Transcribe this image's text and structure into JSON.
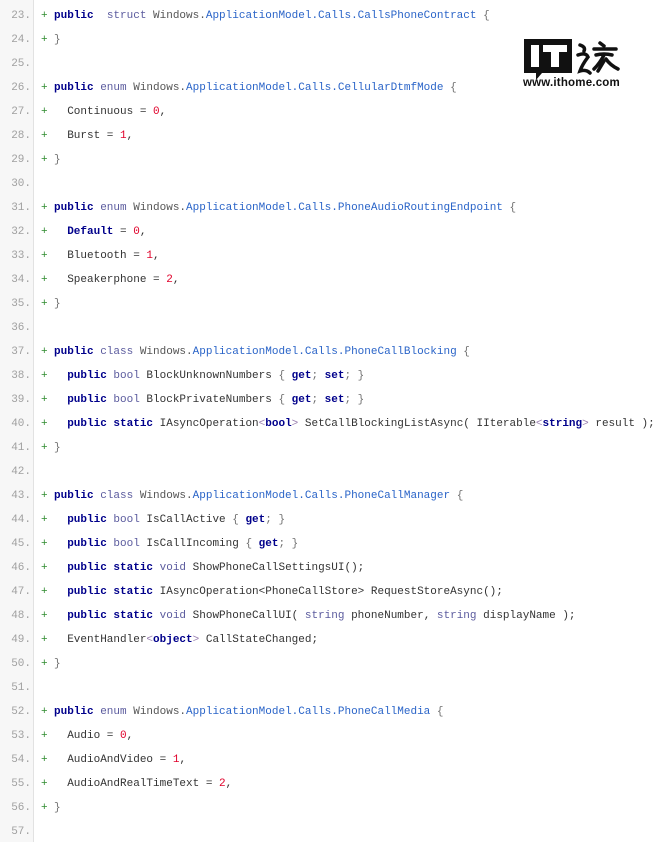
{
  "watermark": {
    "logo_text": "IT之家",
    "url": "www.ithome.com"
  },
  "colors": {
    "plus": "#2e8b2e",
    "keyword": "#00008b",
    "type": "#5b5b9e",
    "class_name": "#2a64c8",
    "number": "#e0002a"
  },
  "lines": [
    {
      "n": "23.",
      "plus": "+",
      "tokens": [
        [
          "kw",
          "public"
        ],
        [
          "",
          "  "
        ],
        [
          "ty",
          "struct"
        ],
        [
          "ns",
          " Windows."
        ],
        [
          "cls",
          "ApplicationModel.Calls.CallsPhoneContract"
        ],
        [
          "br",
          " {"
        ]
      ]
    },
    {
      "n": "24.",
      "plus": "+",
      "tokens": [
        [
          "br",
          "}"
        ]
      ]
    },
    {
      "n": "25.",
      "plus": "",
      "tokens": []
    },
    {
      "n": "26.",
      "plus": "+",
      "tokens": [
        [
          "kw",
          "public"
        ],
        [
          "ty",
          " enum"
        ],
        [
          "ns",
          " Windows."
        ],
        [
          "cls",
          "ApplicationModel.Calls.CellularDtmfMode"
        ],
        [
          "br",
          " {"
        ]
      ]
    },
    {
      "n": "27.",
      "plus": "+",
      "tokens": [
        [
          "",
          "  Continuous = "
        ],
        [
          "num",
          "0"
        ],
        [
          "",
          ","
        ]
      ]
    },
    {
      "n": "28.",
      "plus": "+",
      "tokens": [
        [
          "",
          "  Burst = "
        ],
        [
          "num",
          "1"
        ],
        [
          "",
          ","
        ]
      ]
    },
    {
      "n": "29.",
      "plus": "+",
      "tokens": [
        [
          "br",
          "}"
        ]
      ]
    },
    {
      "n": "30.",
      "plus": "",
      "tokens": []
    },
    {
      "n": "31.",
      "plus": "+",
      "tokens": [
        [
          "kw",
          "public"
        ],
        [
          "ty",
          " enum"
        ],
        [
          "ns",
          " Windows."
        ],
        [
          "cls",
          "ApplicationModel.Calls.PhoneAudioRoutingEndpoint"
        ],
        [
          "br",
          " {"
        ]
      ]
    },
    {
      "n": "32.",
      "plus": "+",
      "tokens": [
        [
          "",
          "  "
        ],
        [
          "kw",
          "Default"
        ],
        [
          "",
          " = "
        ],
        [
          "num",
          "0"
        ],
        [
          "",
          ","
        ]
      ]
    },
    {
      "n": "33.",
      "plus": "+",
      "tokens": [
        [
          "",
          "  Bluetooth = "
        ],
        [
          "num",
          "1"
        ],
        [
          "",
          ","
        ]
      ]
    },
    {
      "n": "34.",
      "plus": "+",
      "tokens": [
        [
          "",
          "  Speakerphone = "
        ],
        [
          "num",
          "2"
        ],
        [
          "",
          ","
        ]
      ]
    },
    {
      "n": "35.",
      "plus": "+",
      "tokens": [
        [
          "br",
          "}"
        ]
      ]
    },
    {
      "n": "36.",
      "plus": "",
      "tokens": []
    },
    {
      "n": "37.",
      "plus": "+",
      "tokens": [
        [
          "kw",
          "public"
        ],
        [
          "ty",
          " class"
        ],
        [
          "ns",
          " Windows."
        ],
        [
          "cls",
          "ApplicationModel.Calls.PhoneCallBlocking"
        ],
        [
          "br",
          " {"
        ]
      ]
    },
    {
      "n": "38.",
      "plus": "+",
      "tokens": [
        [
          "",
          "  "
        ],
        [
          "kw",
          "public"
        ],
        [
          "ty",
          " bool"
        ],
        [
          "",
          " BlockUnknownNumbers "
        ],
        [
          "br",
          "{ "
        ],
        [
          "kw",
          "get"
        ],
        [
          "br",
          "; "
        ],
        [
          "kw",
          "set"
        ],
        [
          "br",
          "; }"
        ]
      ]
    },
    {
      "n": "39.",
      "plus": "+",
      "tokens": [
        [
          "",
          "  "
        ],
        [
          "kw",
          "public"
        ],
        [
          "ty",
          " bool"
        ],
        [
          "",
          " BlockPrivateNumbers "
        ],
        [
          "br",
          "{ "
        ],
        [
          "kw",
          "get"
        ],
        [
          "br",
          "; "
        ],
        [
          "kw",
          "set"
        ],
        [
          "br",
          "; }"
        ]
      ]
    },
    {
      "n": "40.",
      "plus": "+",
      "tokens": [
        [
          "",
          "  "
        ],
        [
          "kw",
          "public static"
        ],
        [
          "",
          " IAsyncOperation"
        ],
        [
          "ang",
          "<"
        ],
        [
          "kw",
          "bool"
        ],
        [
          "ang",
          ">"
        ],
        [
          "",
          " SetCallBlockingListAsync( IIterable"
        ],
        [
          "ang",
          "<"
        ],
        [
          "kw",
          "string"
        ],
        [
          "ang",
          ">"
        ],
        [
          "",
          " result );"
        ]
      ]
    },
    {
      "n": "41.",
      "plus": "+",
      "tokens": [
        [
          "br",
          "}"
        ]
      ]
    },
    {
      "n": "42.",
      "plus": "",
      "tokens": []
    },
    {
      "n": "43.",
      "plus": "+",
      "tokens": [
        [
          "kw",
          "public"
        ],
        [
          "ty",
          " class"
        ],
        [
          "ns",
          " Windows."
        ],
        [
          "cls",
          "ApplicationModel.Calls.PhoneCallManager"
        ],
        [
          "br",
          " {"
        ]
      ]
    },
    {
      "n": "44.",
      "plus": "+",
      "tokens": [
        [
          "",
          "  "
        ],
        [
          "kw",
          "public"
        ],
        [
          "ty",
          " bool"
        ],
        [
          "",
          " IsCallActive "
        ],
        [
          "br",
          "{ "
        ],
        [
          "kw",
          "get"
        ],
        [
          "br",
          "; }"
        ]
      ]
    },
    {
      "n": "45.",
      "plus": "+",
      "tokens": [
        [
          "",
          "  "
        ],
        [
          "kw",
          "public"
        ],
        [
          "ty",
          " bool"
        ],
        [
          "",
          " IsCallIncoming "
        ],
        [
          "br",
          "{ "
        ],
        [
          "kw",
          "get"
        ],
        [
          "br",
          "; }"
        ]
      ]
    },
    {
      "n": "46.",
      "plus": "+",
      "tokens": [
        [
          "",
          "  "
        ],
        [
          "kw",
          "public static"
        ],
        [
          "ty",
          " void"
        ],
        [
          "",
          " ShowPhoneCallSettingsUI();"
        ]
      ]
    },
    {
      "n": "47.",
      "plus": "+",
      "tokens": [
        [
          "",
          "  "
        ],
        [
          "kw",
          "public static"
        ],
        [
          "",
          " IAsyncOperation<PhoneCallStore> RequestStoreAsync();"
        ]
      ]
    },
    {
      "n": "48.",
      "plus": "+",
      "tokens": [
        [
          "",
          "  "
        ],
        [
          "kw",
          "public static"
        ],
        [
          "ty",
          " void"
        ],
        [
          "",
          " ShowPhoneCallUI( "
        ],
        [
          "ty",
          "string"
        ],
        [
          "",
          " phoneNumber, "
        ],
        [
          "ty",
          "string"
        ],
        [
          "",
          " displayName );"
        ]
      ]
    },
    {
      "n": "49.",
      "plus": "+",
      "tokens": [
        [
          "",
          "  EventHandler"
        ],
        [
          "ang",
          "<"
        ],
        [
          "kw",
          "object"
        ],
        [
          "ang",
          ">"
        ],
        [
          "",
          " CallStateChanged;"
        ]
      ]
    },
    {
      "n": "50.",
      "plus": "+",
      "tokens": [
        [
          "br",
          "}"
        ]
      ]
    },
    {
      "n": "51.",
      "plus": "",
      "tokens": []
    },
    {
      "n": "52.",
      "plus": "+",
      "tokens": [
        [
          "kw",
          "public"
        ],
        [
          "ty",
          " enum"
        ],
        [
          "ns",
          " Windows."
        ],
        [
          "cls",
          "ApplicationModel.Calls.PhoneCallMedia"
        ],
        [
          "br",
          " {"
        ]
      ]
    },
    {
      "n": "53.",
      "plus": "+",
      "tokens": [
        [
          "",
          "  Audio = "
        ],
        [
          "num",
          "0"
        ],
        [
          "",
          ","
        ]
      ]
    },
    {
      "n": "54.",
      "plus": "+",
      "tokens": [
        [
          "",
          "  AudioAndVideo = "
        ],
        [
          "num",
          "1"
        ],
        [
          "",
          ","
        ]
      ]
    },
    {
      "n": "55.",
      "plus": "+",
      "tokens": [
        [
          "",
          "  AudioAndRealTimeText = "
        ],
        [
          "num",
          "2"
        ],
        [
          "",
          ","
        ]
      ]
    },
    {
      "n": "56.",
      "plus": "+",
      "tokens": [
        [
          "br",
          "}"
        ]
      ]
    },
    {
      "n": "57.",
      "plus": "",
      "tokens": []
    }
  ]
}
